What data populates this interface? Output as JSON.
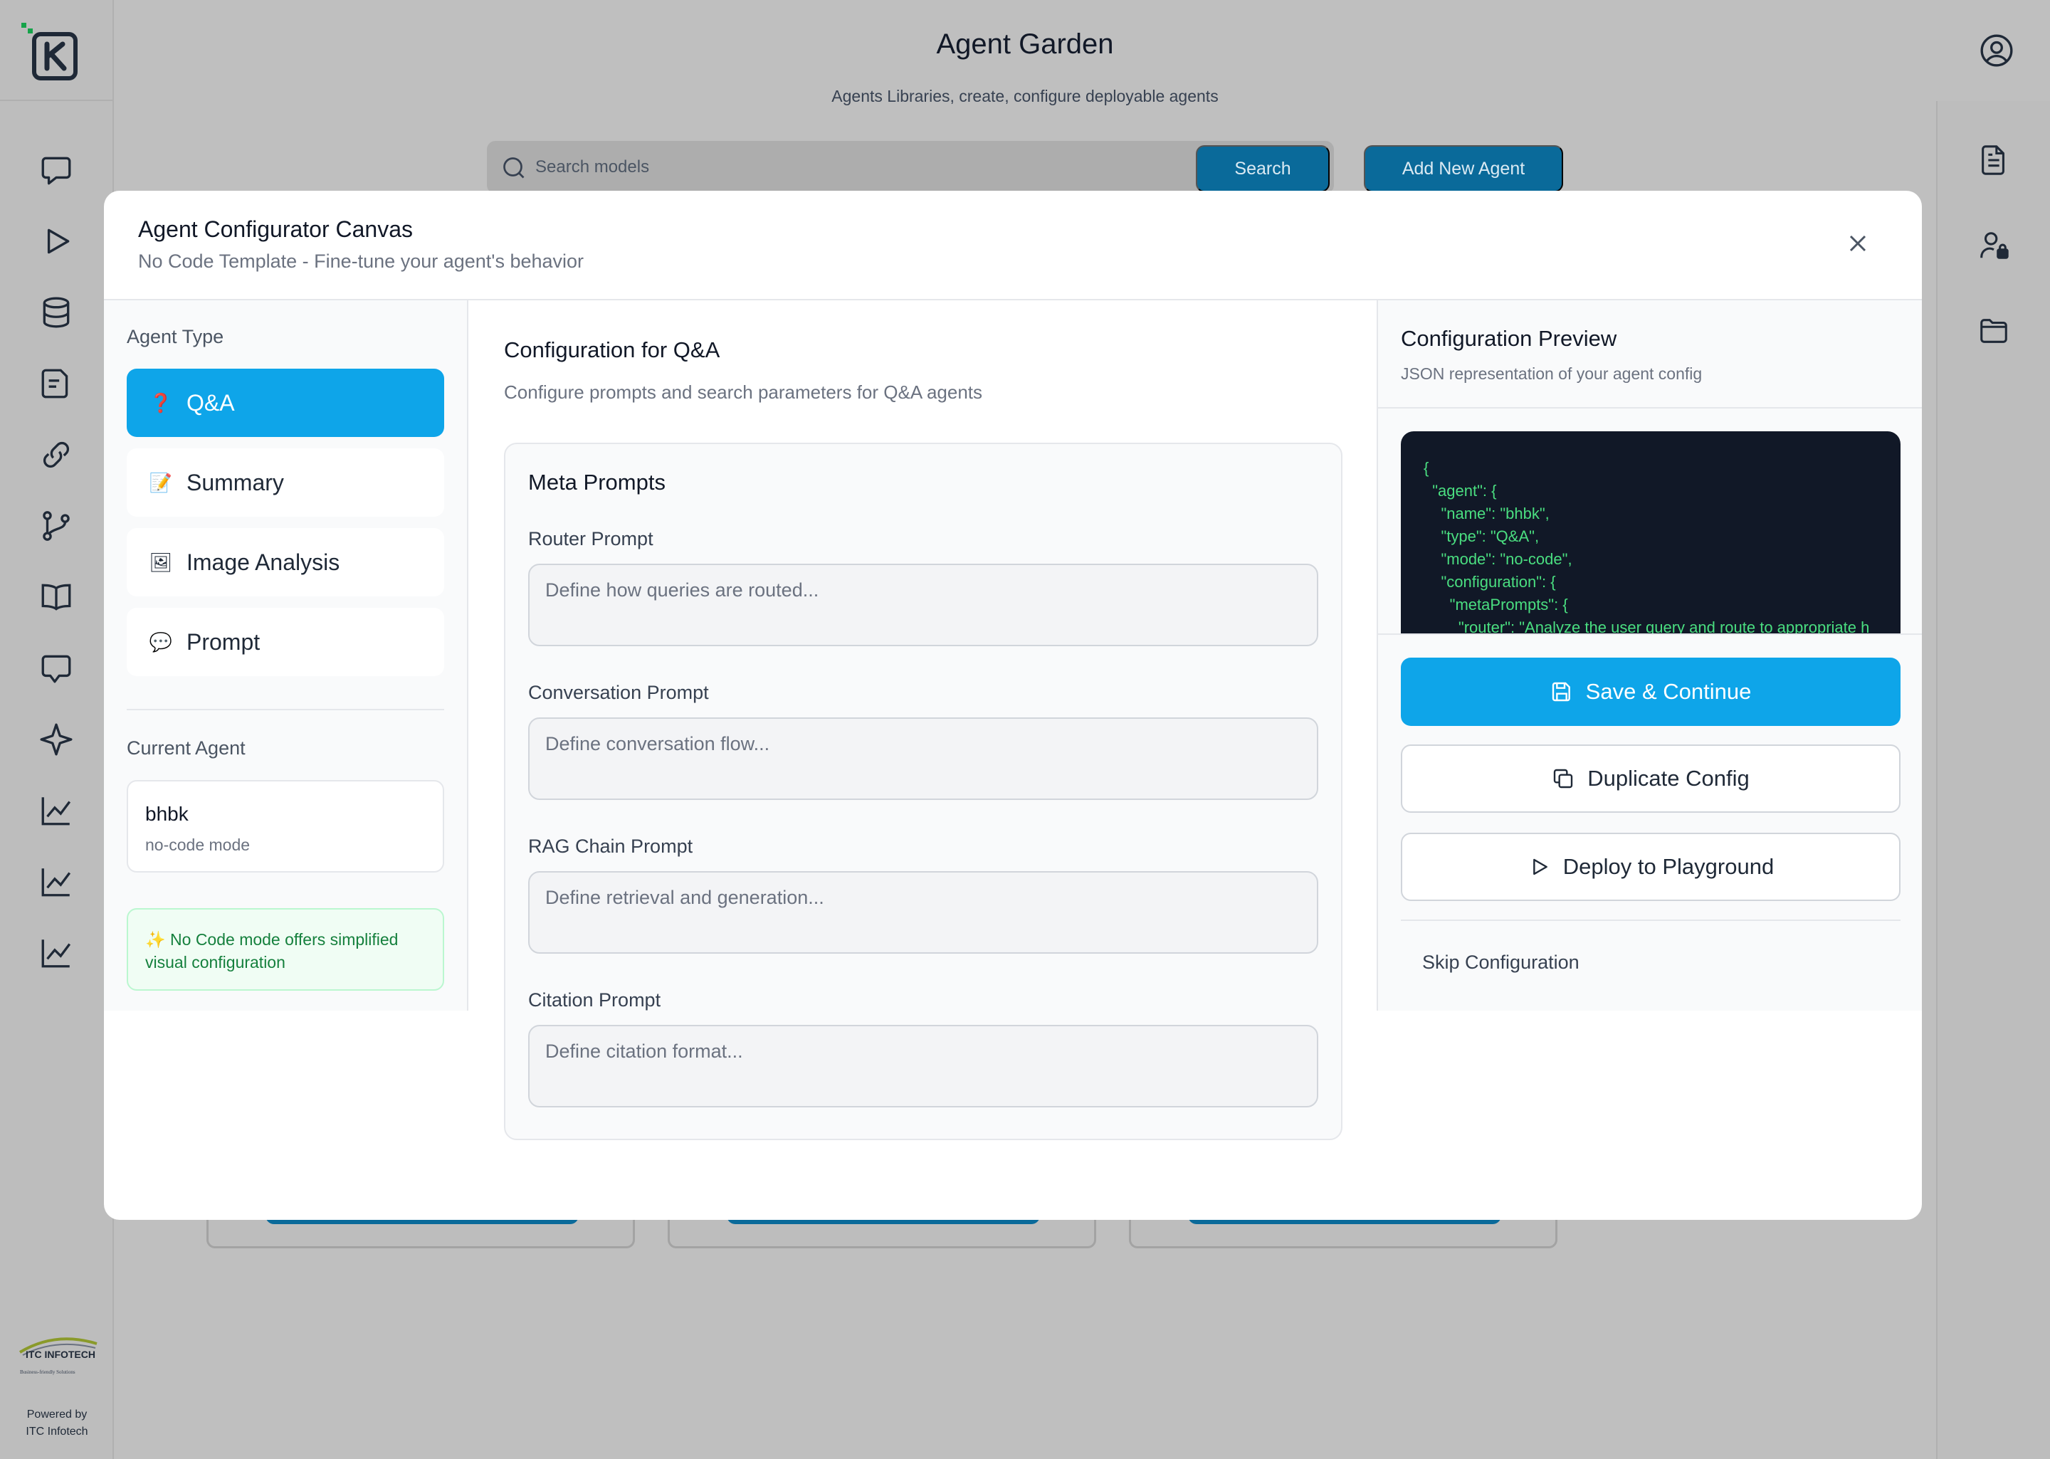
{
  "app": {
    "title": "Agent Garden",
    "subtitle": "Agents Libraries, create, configure deployable agents",
    "search_placeholder": "Search models",
    "search_button": "Search",
    "add_agent_button": "Add New Agent",
    "powered_by_line1": "Powered by",
    "powered_by_line2": "ITC Infotech",
    "logo_text": "ITC INFOTECH",
    "logo_tagline": "Business-friendly Solutions"
  },
  "left_rail_icons": [
    "chat-icon",
    "play-icon",
    "database-icon",
    "note-icon",
    "link-icon",
    "git-branch-icon",
    "book-icon",
    "message-icon",
    "sparkle-icon",
    "chart-icon",
    "chart-icon-2",
    "chart-icon-3"
  ],
  "right_rail_icons": [
    "document-icon",
    "user-lock-icon",
    "folder-icon"
  ],
  "modal": {
    "title": "Agent Configurator Canvas",
    "subtitle": "No Code Template - Fine-tune your agent's behavior"
  },
  "agent_type": {
    "label": "Agent Type",
    "items": [
      {
        "emoji": "❓",
        "label": "Q&A",
        "active": true
      },
      {
        "emoji": "📝",
        "label": "Summary",
        "active": false
      },
      {
        "emoji": "🖼",
        "label": "Image Analysis",
        "active": false
      },
      {
        "emoji": "💬",
        "label": "Prompt",
        "active": false
      }
    ]
  },
  "current_agent": {
    "label": "Current Agent",
    "name": "bhbk",
    "mode": "no-code mode"
  },
  "hint": "✨ No Code mode offers simplified visual configuration",
  "configuration": {
    "title": "Configuration for Q&A",
    "description": "Configure prompts and search parameters for Q&A agents",
    "meta_prompts_title": "Meta Prompts",
    "fields": [
      {
        "label": "Router Prompt",
        "placeholder": "Define how queries are routed...",
        "value": ""
      },
      {
        "label": "Conversation Prompt",
        "placeholder": "Define conversation flow...",
        "value": ""
      },
      {
        "label": "RAG Chain Prompt",
        "placeholder": "Define retrieval and generation...",
        "value": ""
      },
      {
        "label": "Citation Prompt",
        "placeholder": "Define citation format...",
        "value": ""
      }
    ]
  },
  "preview": {
    "title": "Configuration Preview",
    "subtitle": "JSON representation of your agent config",
    "code": "{\n  \"agent\": {\n    \"name\": \"bhbk\",\n    \"type\": \"Q&A\",\n    \"mode\": \"no-code\",\n    \"configuration\": {\n      \"metaPrompts\": {\n        \"router\": \"Analyze the user query and route to appropriate h"
  },
  "actions": {
    "save": "Save & Continue",
    "duplicate": "Duplicate Config",
    "deploy": "Deploy to Playground",
    "skip": "Skip Configuration"
  },
  "colors": {
    "accent": "#0ea5e9",
    "background_button": "#0a6a9a",
    "code_bg": "#111827",
    "code_text": "#4ade80",
    "hint_text": "#15803d"
  }
}
